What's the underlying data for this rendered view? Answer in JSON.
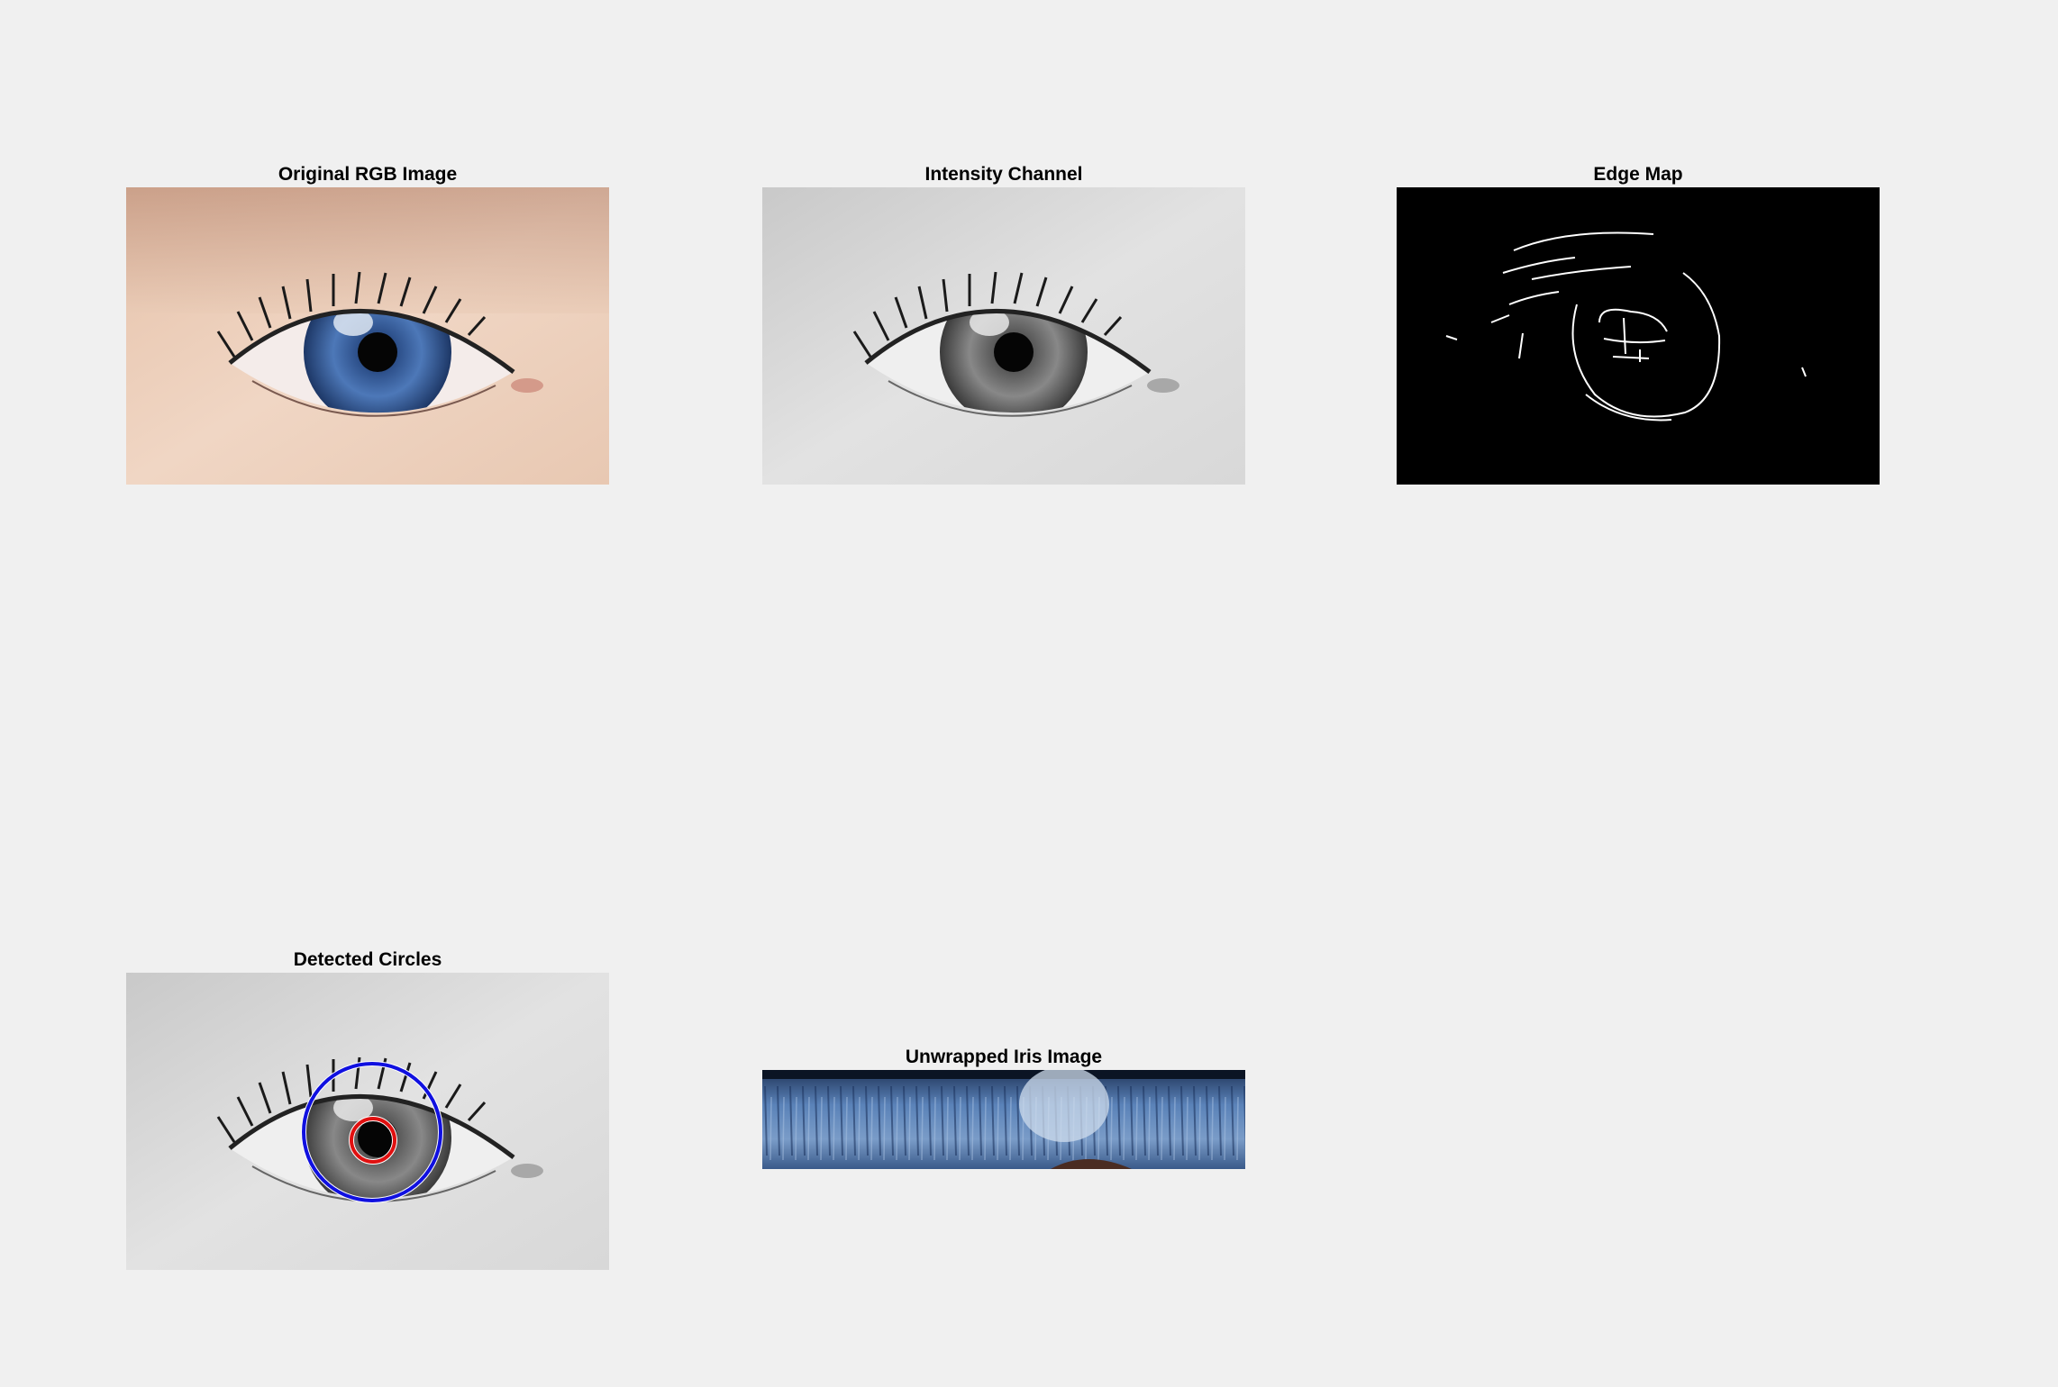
{
  "figure": {
    "panels": [
      {
        "id": "original",
        "title": "Original RGB Image"
      },
      {
        "id": "intensity",
        "title": "Intensity Channel"
      },
      {
        "id": "edges",
        "title": "Edge Map"
      },
      {
        "id": "detected",
        "title": "Detected Circles"
      },
      {
        "id": "unwrapped",
        "title": "Unwrapped Iris Image"
      }
    ]
  },
  "colors": {
    "background": "#f0f0f0",
    "iris_circle": "#1010e0",
    "pupil_circle": "#e01010",
    "edge_lines": "#ffffff",
    "edge_background": "#000000"
  }
}
